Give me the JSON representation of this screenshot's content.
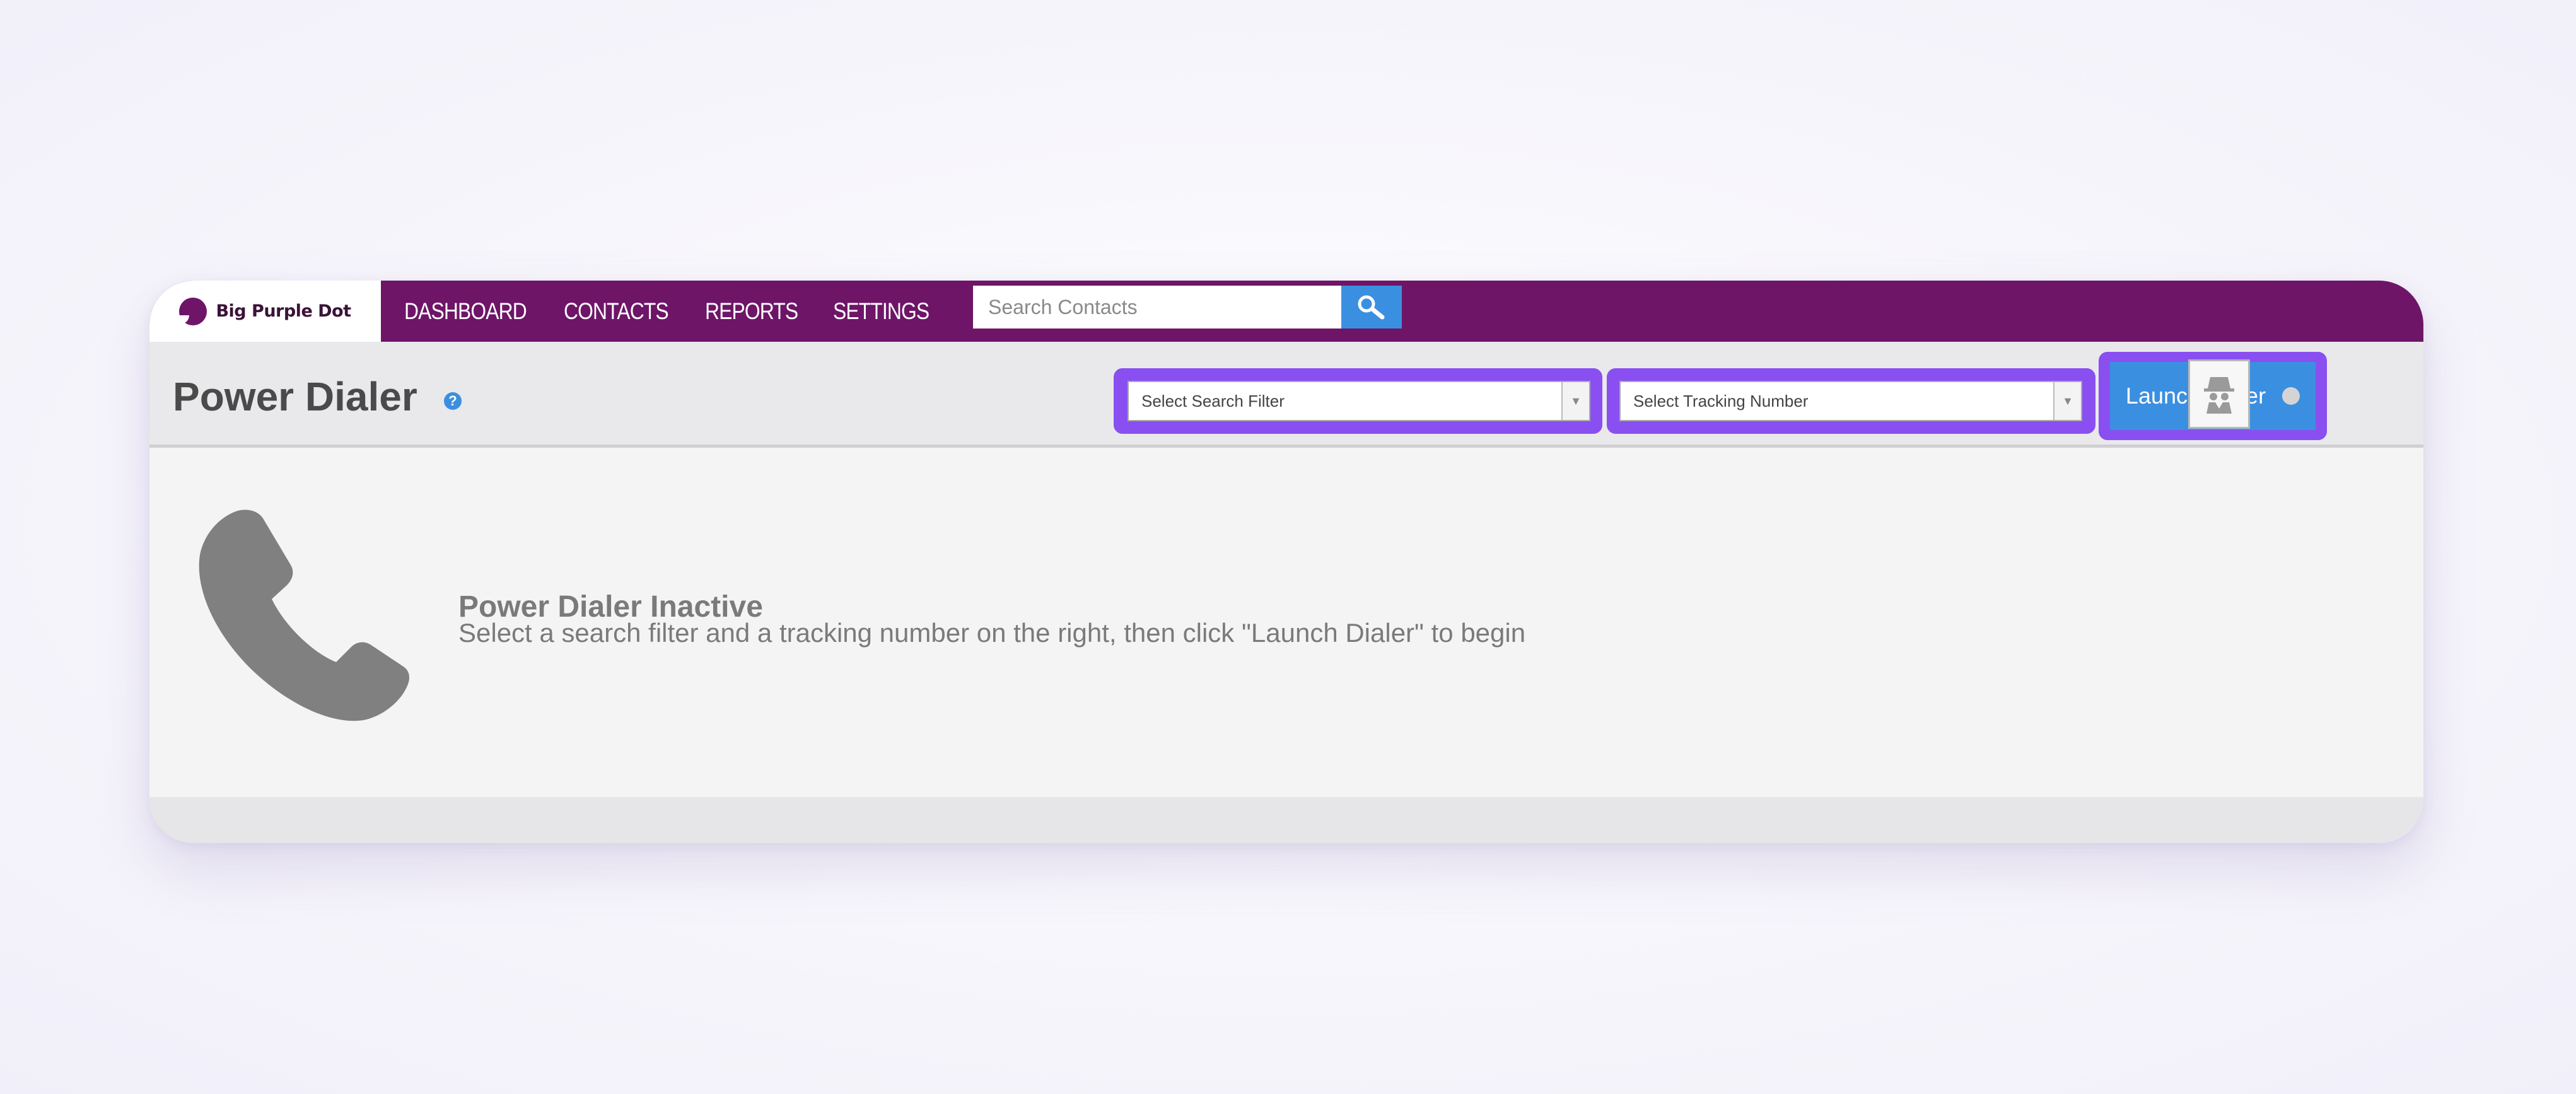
{
  "brand": {
    "name": "Big Purple Dot",
    "color": "#6e1568"
  },
  "nav": {
    "items": [
      "DASHBOARD",
      "CONTACTS",
      "REPORTS",
      "SETTINGS"
    ],
    "search_placeholder": "Search Contacts"
  },
  "header": {
    "title": "Power Dialer",
    "help": "?",
    "search_filter_placeholder": "Select Search Filter",
    "tracking_number_placeholder": "Select Tracking Number",
    "launch_label": "Launch Dialer"
  },
  "status": {
    "title": "Power Dialer Inactive",
    "message": "Select a search filter and a tracking number on the right, then click \"Launch Dialer\" to begin"
  },
  "colors": {
    "accent": "#3b8fe0",
    "highlight": "#8a4ff0"
  },
  "icons": [
    "search-icon",
    "help-icon",
    "chevron-down-icon",
    "incognito-icon",
    "phone-icon"
  ]
}
